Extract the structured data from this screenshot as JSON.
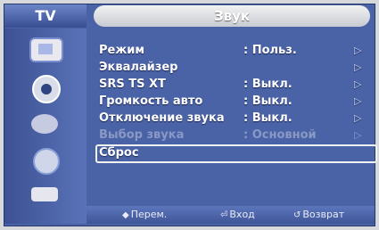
{
  "header": {
    "tab_left": "TV",
    "title": "Звук"
  },
  "sidebar": {
    "icons": [
      "picture-icon",
      "sound-icon",
      "channel-icon",
      "setup-icon",
      "input-icon"
    ]
  },
  "menu": {
    "rows": [
      {
        "label": "Режим",
        "value": ": Польз.",
        "arrow": "▷",
        "enabled": true
      },
      {
        "label": "Эквалайзер",
        "value": "",
        "arrow": "▷",
        "enabled": true
      },
      {
        "label": "SRS TS XT",
        "value": ": Выкл.",
        "arrow": "▷",
        "enabled": true
      },
      {
        "label": "Громкость  авто",
        "value": ": Выкл.",
        "arrow": "▷",
        "enabled": true
      },
      {
        "label": "Отключение звука",
        "value": ": Выкл.",
        "arrow": "▷",
        "enabled": true
      },
      {
        "label": "Выбор  звука",
        "value": ": Основной",
        "arrow": "▷",
        "enabled": false
      },
      {
        "label": "Сброс",
        "value": "",
        "arrow": "",
        "enabled": true,
        "selected": true
      }
    ]
  },
  "footer": {
    "move": "Перем.",
    "enter": "Вход",
    "back": "Возврат"
  },
  "colors": {
    "panel": "#4a63a6",
    "title_bar": "#e6e7ea",
    "text": "#ffffff",
    "disabled_text": "#8a98c6"
  }
}
